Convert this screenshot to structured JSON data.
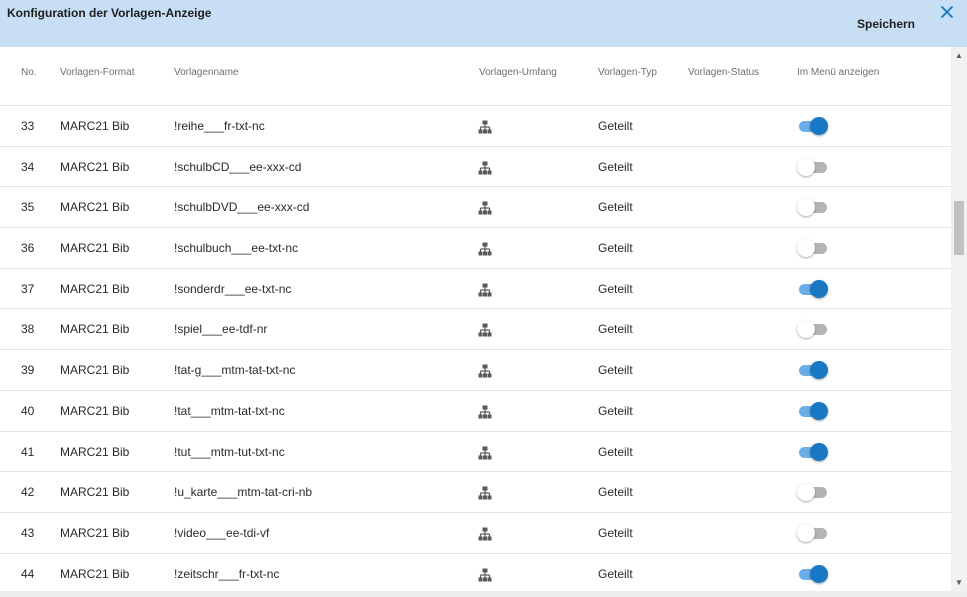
{
  "dialog": {
    "title": "Konfiguration der Vorlagen-Anzeige",
    "save_label": "Speichern",
    "close_icon": "close-icon",
    "accent_color": "#1a78c2",
    "header_color": "#c7def5"
  },
  "table": {
    "columns": [
      {
        "key": "no",
        "label": "No."
      },
      {
        "key": "format",
        "label": "Vorlagen-Format"
      },
      {
        "key": "name",
        "label": "Vorlagenname"
      },
      {
        "key": "scope",
        "label": "Vorlagen-Umfang"
      },
      {
        "key": "type",
        "label": "Vorlagen-Typ"
      },
      {
        "key": "status",
        "label": "Vorlagen-Status"
      },
      {
        "key": "menu",
        "label": "Im Menü anzeigen"
      }
    ],
    "rows": [
      {
        "no": "33",
        "format": "MARC21 Bib",
        "name": "!reihe___fr-txt-nc",
        "scope_icon": "hierarchy-icon",
        "type": "Geteilt",
        "status": "",
        "menu": true
      },
      {
        "no": "34",
        "format": "MARC21 Bib",
        "name": "!schulbCD___ee-xxx-cd",
        "scope_icon": "hierarchy-icon",
        "type": "Geteilt",
        "status": "",
        "menu": false
      },
      {
        "no": "35",
        "format": "MARC21 Bib",
        "name": "!schulbDVD___ee-xxx-cd",
        "scope_icon": "hierarchy-icon",
        "type": "Geteilt",
        "status": "",
        "menu": false
      },
      {
        "no": "36",
        "format": "MARC21 Bib",
        "name": "!schulbuch___ee-txt-nc",
        "scope_icon": "hierarchy-icon",
        "type": "Geteilt",
        "status": "",
        "menu": false
      },
      {
        "no": "37",
        "format": "MARC21 Bib",
        "name": "!sonderdr___ee-txt-nc",
        "scope_icon": "hierarchy-icon",
        "type": "Geteilt",
        "status": "",
        "menu": true
      },
      {
        "no": "38",
        "format": "MARC21 Bib",
        "name": "!spiel___ee-tdf-nr",
        "scope_icon": "hierarchy-icon",
        "type": "Geteilt",
        "status": "",
        "menu": false
      },
      {
        "no": "39",
        "format": "MARC21 Bib",
        "name": "!tat-g___mtm-tat-txt-nc",
        "scope_icon": "hierarchy-icon",
        "type": "Geteilt",
        "status": "",
        "menu": true
      },
      {
        "no": "40",
        "format": "MARC21 Bib",
        "name": "!tat___mtm-tat-txt-nc",
        "scope_icon": "hierarchy-icon",
        "type": "Geteilt",
        "status": "",
        "menu": true
      },
      {
        "no": "41",
        "format": "MARC21 Bib",
        "name": "!tut___mtm-tut-txt-nc",
        "scope_icon": "hierarchy-icon",
        "type": "Geteilt",
        "status": "",
        "menu": true
      },
      {
        "no": "42",
        "format": "MARC21 Bib",
        "name": "!u_karte___mtm-tat-cri-nb",
        "scope_icon": "hierarchy-icon",
        "type": "Geteilt",
        "status": "",
        "menu": false
      },
      {
        "no": "43",
        "format": "MARC21 Bib",
        "name": "!video___ee-tdi-vf",
        "scope_icon": "hierarchy-icon",
        "type": "Geteilt",
        "status": "",
        "menu": false
      },
      {
        "no": "44",
        "format": "MARC21 Bib",
        "name": "!zeitschr___fr-txt-nc",
        "scope_icon": "hierarchy-icon",
        "type": "Geteilt",
        "status": "",
        "menu": true
      }
    ]
  }
}
